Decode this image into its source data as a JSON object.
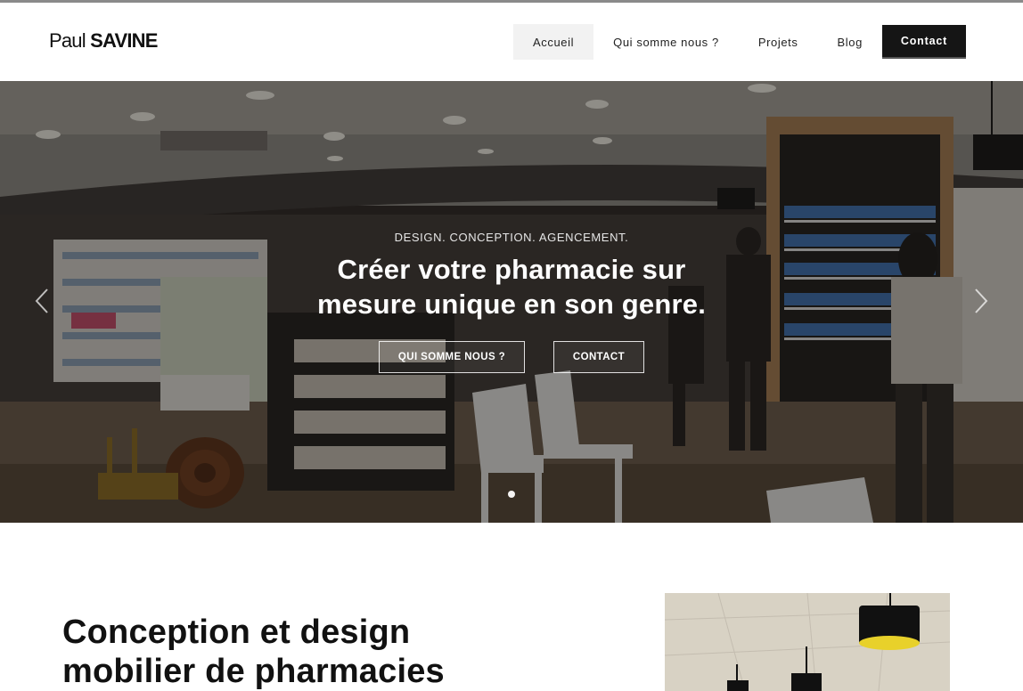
{
  "brand": {
    "first": "Paul",
    "last": "SAVINE"
  },
  "nav": {
    "items": [
      {
        "label": "Accueil",
        "active": true
      },
      {
        "label": "Qui somme nous ?"
      },
      {
        "label": "Projets"
      },
      {
        "label": "Blog"
      }
    ],
    "contact_label": "Contact"
  },
  "hero": {
    "kicker": "DESIGN. CONCEPTION. AGENCEMENT.",
    "title_line1": "Créer votre pharmacie sur",
    "title_line2": "mesure unique en son genre.",
    "button_primary": "QUI SOMME NOUS ?",
    "button_secondary": "CONTACT",
    "prev_icon": "chevron-left-icon",
    "next_icon": "chevron-right-icon"
  },
  "section": {
    "title_line1": "Conception et design",
    "title_line2": "mobilier de pharmacies"
  },
  "colors": {
    "dark": "#151515",
    "nav_active_bg": "#f2f2f2",
    "top_rule": "#8a8a8a"
  }
}
